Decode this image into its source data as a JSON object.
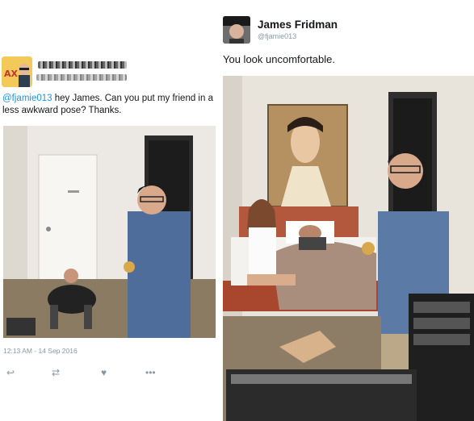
{
  "original_tweet": {
    "mention": "@fjamie013",
    "text": " hey James. Can you put my friend in a less awkward pose? Thanks.",
    "timestamp": "12:13 AM - 14 Sep 2016"
  },
  "reply_tweet": {
    "author_name": "James Fridman",
    "author_handle": "@fjamie013",
    "text": "You look uncomfortable."
  },
  "icons": {
    "reply": "reply-icon",
    "retweet": "retweet-icon",
    "like": "heart-icon",
    "more": "more-icon"
  },
  "colors": {
    "link": "#1b95e0",
    "muted": "#8899a6"
  }
}
